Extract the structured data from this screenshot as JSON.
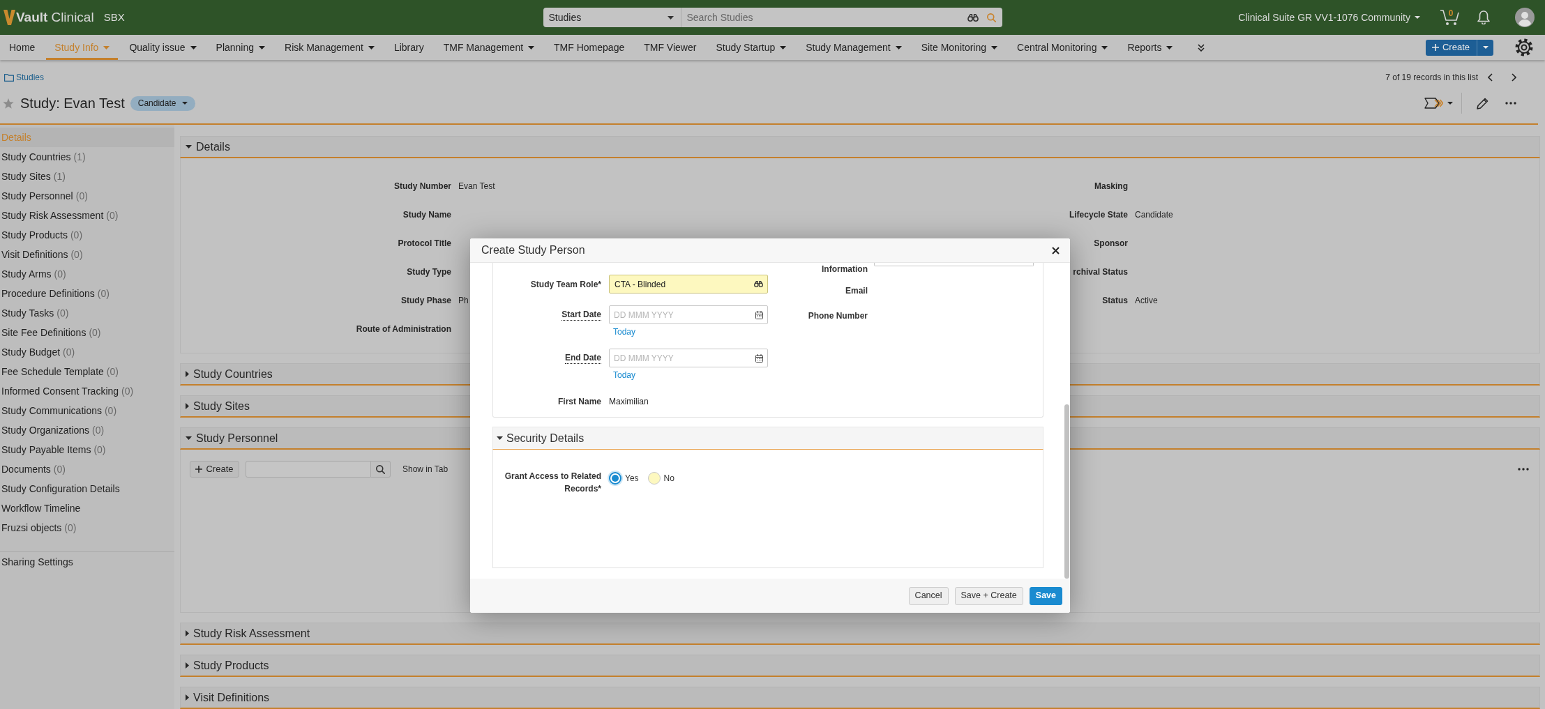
{
  "top_bar": {
    "brand": "Vault",
    "product": "Clinical",
    "environment": "SBX",
    "search": {
      "scope": "Studies",
      "placeholder": "Search Studies"
    },
    "vault_menu": "Clinical Suite GR VV1-1076 Community",
    "cart_count": "0"
  },
  "nav": {
    "items": [
      {
        "label": "Home",
        "selected": false,
        "dropdown": false
      },
      {
        "label": "Study Info",
        "selected": true,
        "dropdown": true
      },
      {
        "label": "Quality issue",
        "selected": false,
        "dropdown": true
      },
      {
        "label": "Planning",
        "selected": false,
        "dropdown": true
      },
      {
        "label": "Risk Management",
        "selected": false,
        "dropdown": true
      },
      {
        "label": "Library",
        "selected": false,
        "dropdown": false
      },
      {
        "label": "TMF Management",
        "selected": false,
        "dropdown": true
      },
      {
        "label": "TMF Homepage",
        "selected": false,
        "dropdown": false
      },
      {
        "label": "TMF Viewer",
        "selected": false,
        "dropdown": false
      },
      {
        "label": "Study Startup",
        "selected": false,
        "dropdown": true
      },
      {
        "label": "Study Management",
        "selected": false,
        "dropdown": true
      },
      {
        "label": "Site Monitoring",
        "selected": false,
        "dropdown": true
      },
      {
        "label": "Central Monitoring",
        "selected": false,
        "dropdown": true
      },
      {
        "label": "Reports",
        "selected": false,
        "dropdown": true
      }
    ],
    "create_button": "Create"
  },
  "record_header": {
    "breadcrumb": "Studies",
    "title": "Study: Evan Test",
    "state": "Candidate",
    "favorite": false,
    "record_position": "7 of 19 records in this list"
  },
  "sidebar": {
    "items": [
      {
        "label": "Details",
        "selected": true
      },
      {
        "label": "Study Countries",
        "count": "(1)",
        "selected": false
      },
      {
        "label": "Study Sites",
        "count": "(1)",
        "selected": false
      },
      {
        "label": "Study Personnel",
        "count": "(0)",
        "selected": false
      },
      {
        "label": "Study Risk Assessment",
        "count": "(0)",
        "selected": false
      },
      {
        "label": "Study Products",
        "count": "(0)",
        "selected": false
      },
      {
        "label": "Visit Definitions",
        "count": "(0)",
        "selected": false
      },
      {
        "label": "Study Arms",
        "count": "(0)",
        "selected": false
      },
      {
        "label": "Procedure Definitions",
        "count": "(0)",
        "selected": false
      },
      {
        "label": "Study Tasks",
        "count": "(0)",
        "selected": false
      },
      {
        "label": "Site Fee Definitions",
        "count": "(0)",
        "selected": false
      },
      {
        "label": "Study Budget",
        "count": "(0)",
        "selected": false
      },
      {
        "label": "Fee Schedule Template",
        "count": "(0)",
        "selected": false
      },
      {
        "label": "Informed Consent Tracking",
        "count": "(0)",
        "selected": false
      },
      {
        "label": "Study Communications",
        "count": "(0)",
        "selected": false
      },
      {
        "label": "Study Organizations",
        "count": "(0)",
        "selected": false
      },
      {
        "label": "Study Payable Items",
        "count": "(0)",
        "selected": false
      },
      {
        "label": "Documents",
        "count": "(0)",
        "selected": false
      },
      {
        "label": "Study Configuration Details",
        "selected": false
      },
      {
        "label": "Workflow Timeline",
        "selected": false
      },
      {
        "label": "Fruzsi objects",
        "count": "(0)",
        "selected": false
      }
    ],
    "footer_items": [
      {
        "label": "Sharing Settings"
      }
    ]
  },
  "sections": [
    {
      "title": "Details",
      "expanded": true,
      "fields_left": [
        {
          "label": "Study Number",
          "value": "Evan Test"
        },
        {
          "label": "Study Name"
        },
        {
          "label": "Protocol Title"
        },
        {
          "label": "Study Type"
        },
        {
          "label": "Study Phase",
          "value": "Ph"
        },
        {
          "label": "Route of Administration"
        }
      ],
      "fields_right": [
        {
          "label": "Masking"
        },
        {
          "label": "Lifecycle State",
          "value": "Candidate"
        },
        {
          "label": "Sponsor"
        },
        {
          "label": "rchival Status"
        },
        {
          "label": "Status",
          "value": "Active"
        }
      ]
    },
    {
      "title": "Study Countries",
      "expanded": false
    },
    {
      "title": "Study Sites",
      "expanded": false
    },
    {
      "title": "Study Personnel",
      "expanded": true,
      "related_list": {
        "create_button": "Create",
        "show_in_tab": "Show in Tab"
      }
    },
    {
      "title": "Study Risk Assessment",
      "expanded": false
    },
    {
      "title": "Study Products",
      "expanded": false
    },
    {
      "title": "Visit Definitions",
      "expanded": false
    }
  ],
  "modal": {
    "title": "Create Study Person",
    "fields_left": [
      {
        "kind": "lookup",
        "label": "Study Team Role*",
        "value": "CTA - Blinded",
        "required": true,
        "help": false
      },
      {
        "kind": "date",
        "label": "Start Date",
        "placeholder": "DD MMM YYYY",
        "link": "Today",
        "required": false,
        "help": true
      },
      {
        "kind": "date",
        "label": "End Date",
        "placeholder": "DD MMM YYYY",
        "link": "Today",
        "required": false,
        "help": true
      },
      {
        "kind": "readonly",
        "label": "First Name",
        "value": "Maximilian",
        "help": false
      }
    ],
    "fields_right": [
      {
        "kind": "input",
        "label": "Information"
      },
      {
        "kind": "readonly",
        "label": "Email"
      },
      {
        "kind": "readonly",
        "label": "Phone Number"
      }
    ],
    "security": {
      "title": "Security Details",
      "expanded": true,
      "fields": [
        {
          "kind": "radio",
          "label": "Grant Access to Related Records*",
          "required": true,
          "options": [
            {
              "label": "Yes",
              "selected": true
            },
            {
              "label": "No",
              "selected": false
            }
          ]
        }
      ]
    },
    "buttons": [
      {
        "label": "Cancel",
        "kind": "secondary"
      },
      {
        "label": "Save + Create",
        "kind": "secondary"
      },
      {
        "label": "Save",
        "kind": "primary"
      }
    ]
  }
}
